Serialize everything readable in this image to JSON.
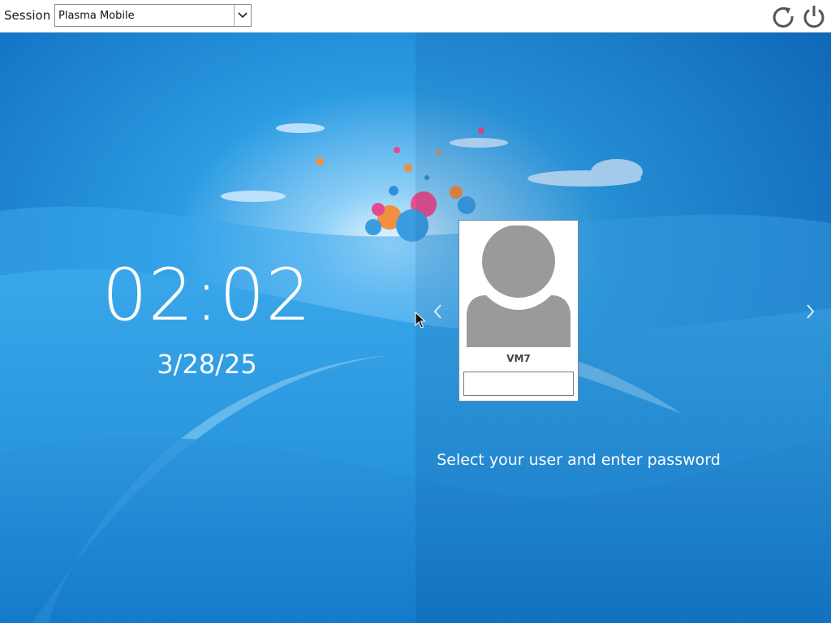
{
  "session": {
    "label": "Session",
    "selected": "Plasma Mobile"
  },
  "toolbar": {
    "restart_icon": "restart-icon",
    "shutdown_icon": "power-icon"
  },
  "clock": {
    "time": "02:02",
    "date": "3/28/25"
  },
  "users": {
    "current": "VM7",
    "password_value": ""
  },
  "hint": "Select your user and enter password",
  "colors": {
    "background_top": "#0b6ec4",
    "background_mid": "#2a9ae3",
    "text": "#ffffff",
    "avatar": "#9a9a9a"
  }
}
